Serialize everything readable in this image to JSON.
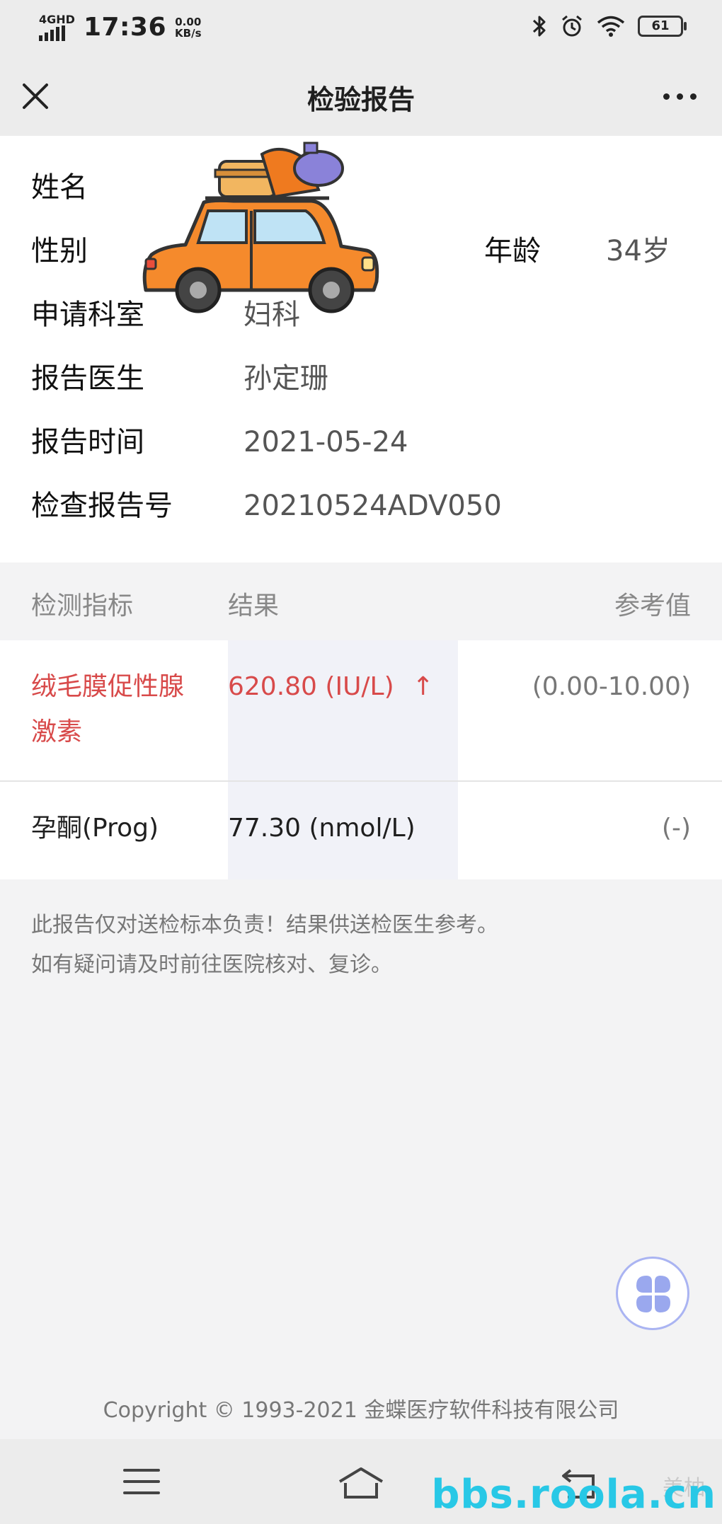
{
  "status_bar": {
    "network": "4GHD",
    "time": "17:36",
    "speed_value": "0.00",
    "speed_unit": "KB/s",
    "battery": "61"
  },
  "nav": {
    "title": "检验报告"
  },
  "patient": {
    "name_label": "姓名",
    "gender_label": "性别",
    "age_label": "年龄",
    "age_value": "34岁",
    "department_label": "申请科室",
    "department_value": "妇科",
    "doctor_label": "报告医生",
    "doctor_value": "孙定珊",
    "time_label": "报告时间",
    "time_value": "2021-05-24",
    "report_no_label": "检查报告号",
    "report_no_value": "20210524ADV050"
  },
  "table": {
    "headers": [
      "检测指标",
      "结果",
      "参考值"
    ],
    "rows": [
      {
        "name": "绒毛膜促性腺激素",
        "result": "620.80  (IU/L)",
        "flag": "↑",
        "reference": "(0.00-10.00)"
      },
      {
        "name": "孕酮(Prog)",
        "result": "77.30  (nmol/L)",
        "flag": "",
        "reference": "(-)"
      }
    ]
  },
  "note": {
    "line1": "此报告仅对送检标本负责！结果供送检医生参考。",
    "line2": "如有疑问请及时前往医院核对、复诊。"
  },
  "footer": {
    "copyright": "Copyright © 1993-2021 金蝶医疗软件科技有限公司"
  },
  "watermark": {
    "text": "bbs.roola.cn",
    "text2": "美柚"
  },
  "colors": {
    "abnormal": "#d84a4a",
    "highlight_column": "#f1f2f8",
    "fab_border": "#aab4f2",
    "watermark": "#28c8e6"
  }
}
